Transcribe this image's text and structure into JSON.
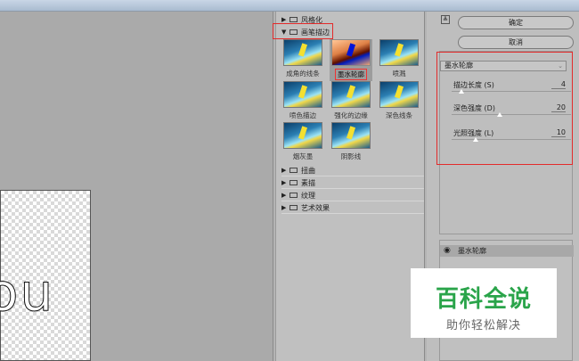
{
  "gallery": {
    "folders_top": [
      {
        "arrow": "▶",
        "label": "风格化"
      },
      {
        "arrow": "▼",
        "label": "画笔描边"
      }
    ],
    "thumbs": [
      {
        "label": "成角的线条"
      },
      {
        "label": "墨水轮廓"
      },
      {
        "label": "喷溅"
      },
      {
        "label": "喷色描边"
      },
      {
        "label": "强化的边缘"
      },
      {
        "label": "深色线条"
      },
      {
        "label": "烟灰墨"
      },
      {
        "label": "阴影线"
      }
    ],
    "folders_bottom": [
      {
        "arrow": "▶",
        "label": "扭曲"
      },
      {
        "arrow": "▶",
        "label": "素描"
      },
      {
        "arrow": "▶",
        "label": "纹理"
      },
      {
        "arrow": "▶",
        "label": "艺术效果"
      }
    ]
  },
  "preview": {
    "canvas_text": "ou"
  },
  "panel": {
    "ok_label": "确定",
    "cancel_label": "取消",
    "toggle_glyph": "≜",
    "filter_select": "墨水轮廓",
    "params": [
      {
        "name": "描边长度 (S)",
        "value": "4",
        "level": 0.08
      },
      {
        "name": "深色强度 (D)",
        "value": "20",
        "level": 0.4
      },
      {
        "name": "光照强度 (L)",
        "value": "10",
        "level": 0.2
      }
    ],
    "layer_name": "墨水轮廓"
  },
  "watermark": {
    "title": "百科全说",
    "subtitle": "助你轻松解决"
  }
}
